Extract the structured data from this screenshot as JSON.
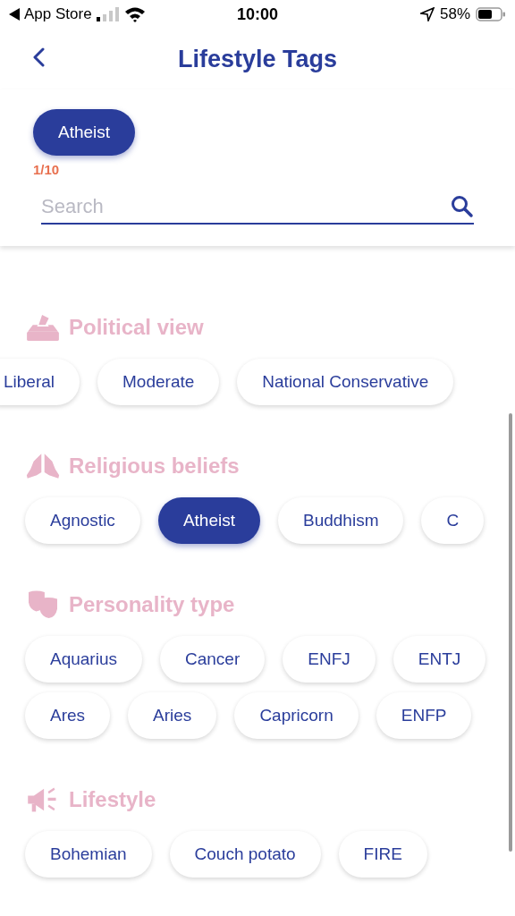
{
  "status_bar": {
    "back_app": "App Store",
    "time": "10:00",
    "battery": "58%"
  },
  "nav": {
    "title": "Lifestyle Tags"
  },
  "selected_tags": [
    {
      "label": "Atheist"
    }
  ],
  "count": "1/10",
  "search": {
    "placeholder": "Search"
  },
  "sections": [
    {
      "title": "Political view",
      "rows": [
        {
          "scrolled": true,
          "chips": [
            {
              "label": "Liberal",
              "selected": false
            },
            {
              "label": "Moderate",
              "selected": false
            },
            {
              "label": "National Conservative",
              "selected": false
            }
          ]
        }
      ]
    },
    {
      "title": "Religious beliefs",
      "rows": [
        {
          "scrolled": false,
          "chips": [
            {
              "label": "Agnostic",
              "selected": false
            },
            {
              "label": "Atheist",
              "selected": true
            },
            {
              "label": "Buddhism",
              "selected": false
            },
            {
              "label": "C",
              "selected": false
            }
          ]
        }
      ]
    },
    {
      "title": "Personality type",
      "rows": [
        {
          "scrolled": false,
          "chips": [
            {
              "label": "Aquarius",
              "selected": false
            },
            {
              "label": "Cancer",
              "selected": false
            },
            {
              "label": "ENFJ",
              "selected": false
            },
            {
              "label": "ENTJ",
              "selected": false
            }
          ]
        },
        {
          "scrolled": false,
          "chips": [
            {
              "label": "Ares",
              "selected": false
            },
            {
              "label": "Aries",
              "selected": false
            },
            {
              "label": "Capricorn",
              "selected": false
            },
            {
              "label": "ENFP",
              "selected": false
            }
          ]
        }
      ]
    },
    {
      "title": "Lifestyle",
      "rows": [
        {
          "scrolled": false,
          "chips": [
            {
              "label": "Bohemian",
              "selected": false
            },
            {
              "label": "Couch potato",
              "selected": false
            },
            {
              "label": "FIRE",
              "selected": false
            }
          ]
        }
      ]
    }
  ]
}
